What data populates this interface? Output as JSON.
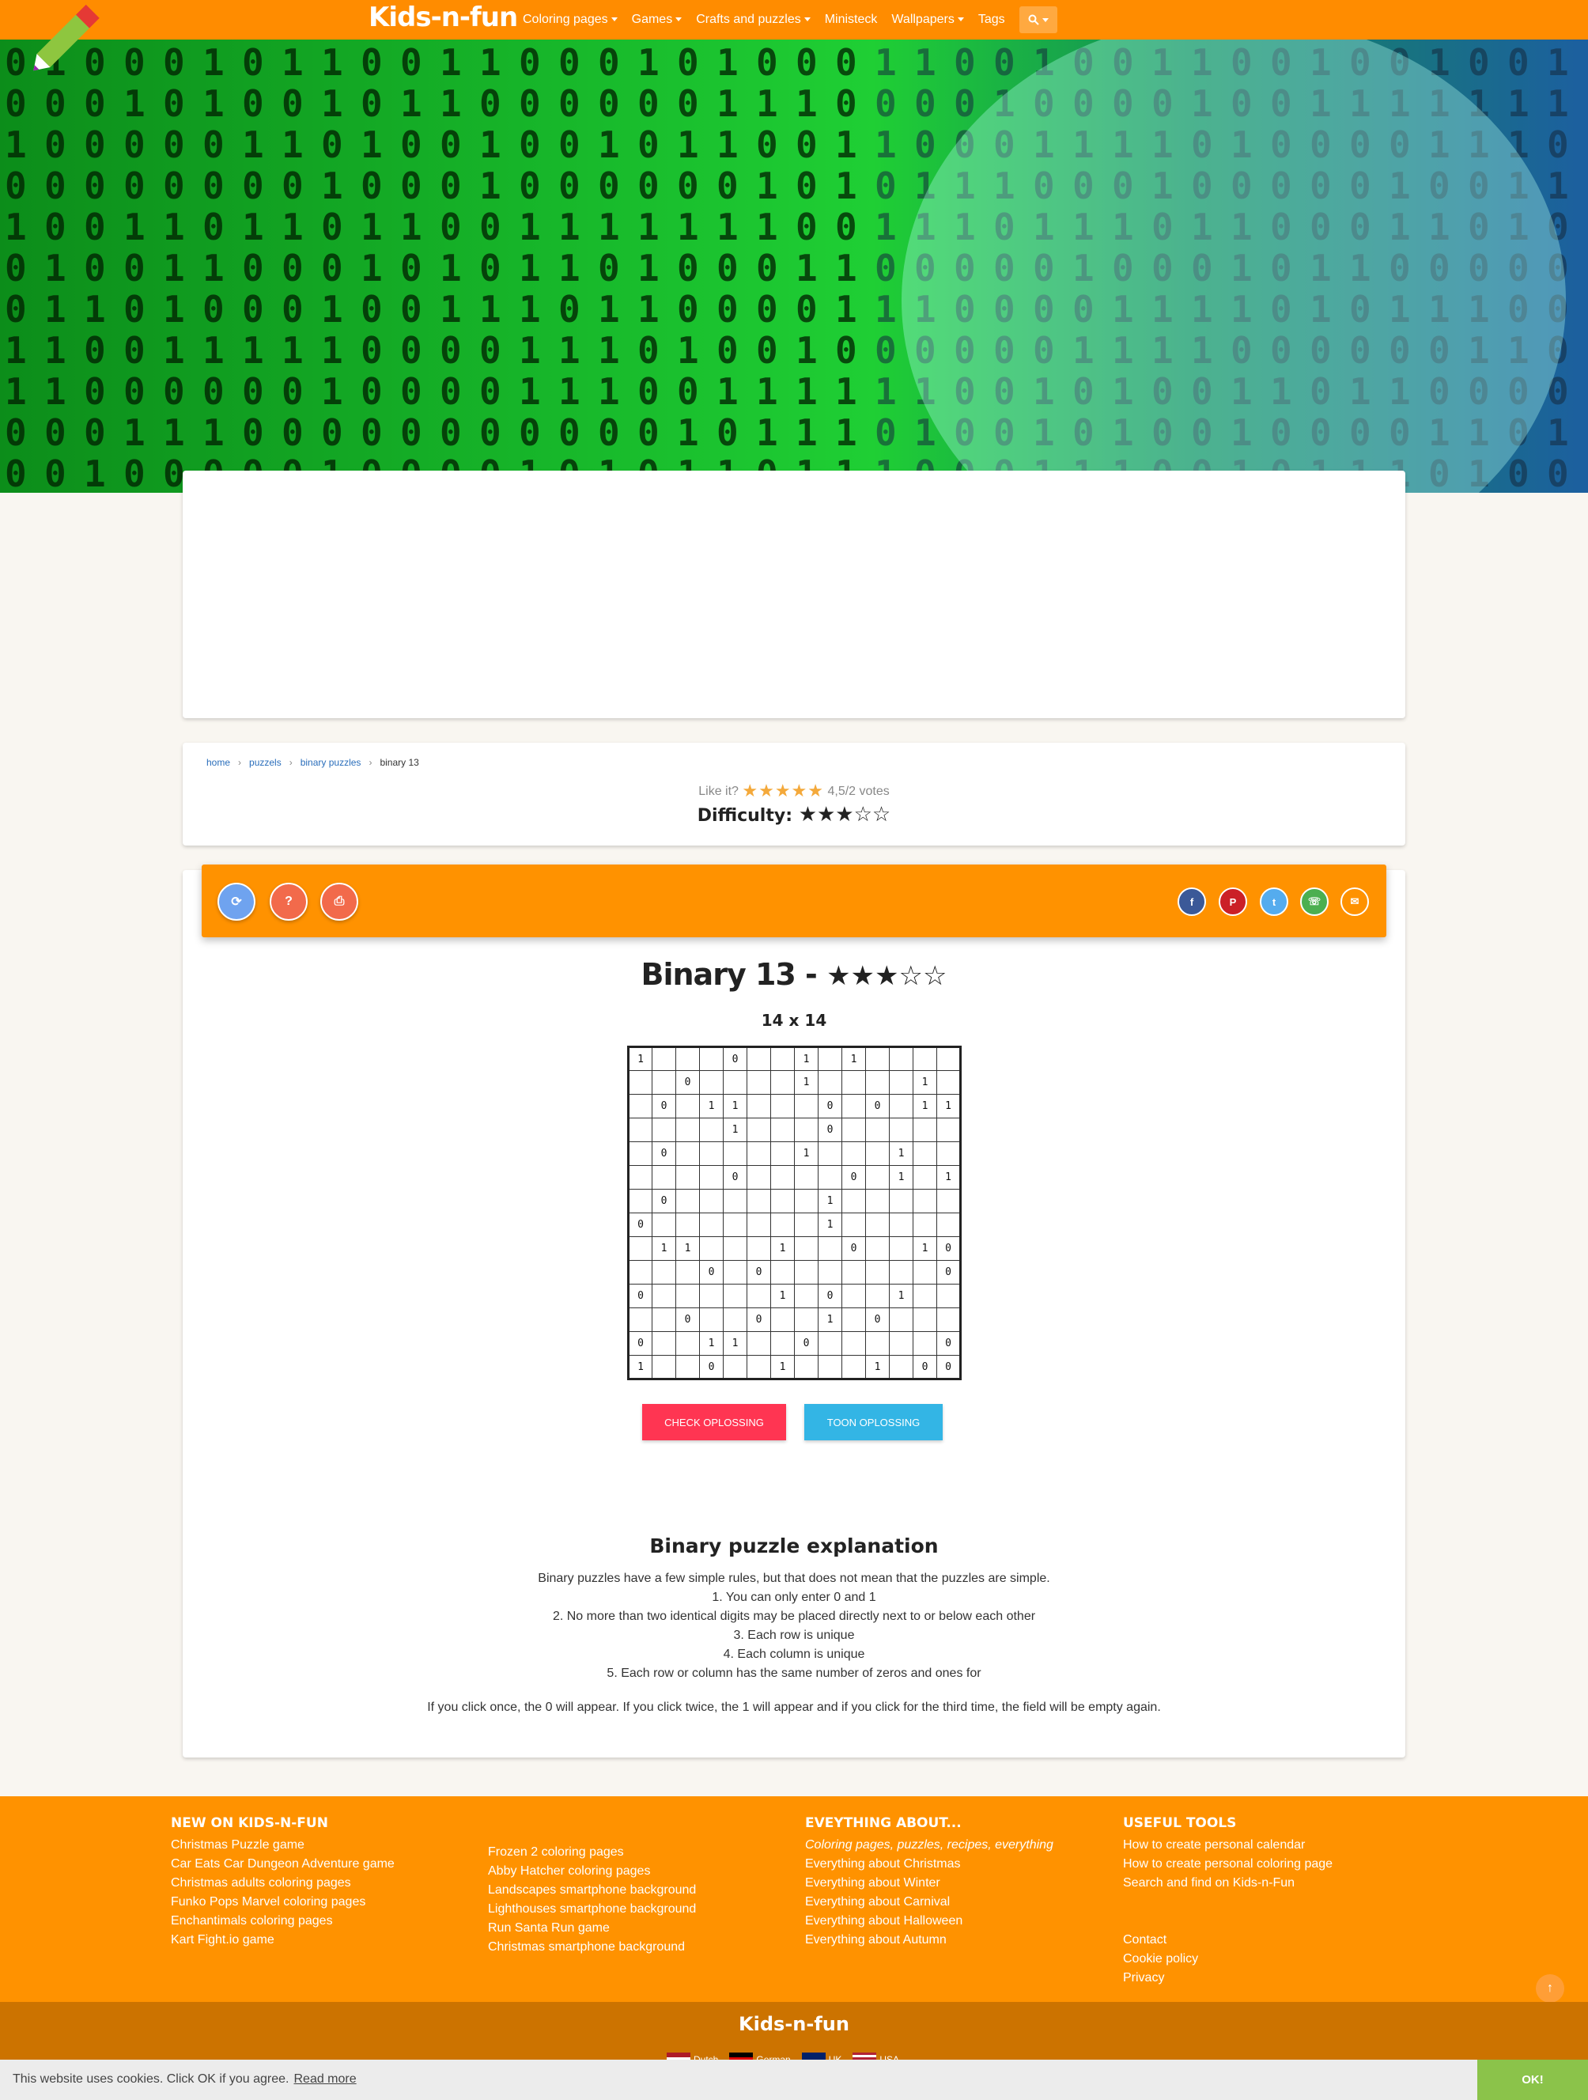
{
  "nav": {
    "brand": "Kids-n-fun",
    "items": [
      {
        "label": "Coloring pages",
        "dropdown": true
      },
      {
        "label": "Games",
        "dropdown": true
      },
      {
        "label": "Crafts and puzzles",
        "dropdown": true
      },
      {
        "label": "Ministeck",
        "dropdown": false
      },
      {
        "label": "Wallpapers",
        "dropdown": true
      },
      {
        "label": "Tags",
        "dropdown": false
      }
    ],
    "search_icon": "search-icon"
  },
  "breadcrumb": {
    "items": [
      "home",
      "puzzels",
      "binary puzzles"
    ],
    "current": "binary 13"
  },
  "rating": {
    "prefix": "Like it?",
    "stars": "★★★★★",
    "votes": "4,5/2 votes",
    "difficulty_label": "Difficulty:",
    "difficulty_stars": "★★★☆☆",
    "difficulty_level": 3
  },
  "toolbar": {
    "tools": [
      {
        "icon": "refresh-icon",
        "glyph": "⟳",
        "color": "#6fa3ef"
      },
      {
        "icon": "help-icon",
        "glyph": "?",
        "color": "#f26a4b"
      },
      {
        "icon": "print-icon",
        "glyph": "⎙",
        "color": "#f26a4b"
      }
    ],
    "share": [
      {
        "icon": "facebook-icon",
        "glyph": "f",
        "color": "#3b5998"
      },
      {
        "icon": "pinterest-icon",
        "glyph": "P",
        "color": "#cb2027"
      },
      {
        "icon": "twitter-icon",
        "glyph": "t",
        "color": "#55acee"
      },
      {
        "icon": "whatsapp-icon",
        "glyph": "☏",
        "color": "#4caf50"
      },
      {
        "icon": "email-icon",
        "glyph": "✉",
        "color": "#ff9200"
      }
    ]
  },
  "puzzle": {
    "title": "Binary 13 -",
    "title_stars": "★★★☆☆",
    "size": "14 x 14",
    "grid": [
      [
        "1",
        "",
        "",
        "",
        "0",
        "",
        "",
        "1",
        "",
        "1",
        "",
        "",
        "",
        ""
      ],
      [
        "",
        "",
        "0",
        "",
        "",
        "",
        "",
        "1",
        "",
        "",
        "",
        "",
        "1",
        ""
      ],
      [
        "",
        "0",
        "",
        "1",
        "1",
        "",
        "",
        "",
        "0",
        "",
        "0",
        "",
        "1",
        "1"
      ],
      [
        "",
        "",
        "",
        "",
        "1",
        "",
        "",
        "",
        "0",
        "",
        "",
        "",
        "",
        ""
      ],
      [
        "",
        "0",
        "",
        "",
        "",
        "",
        "",
        "1",
        "",
        "",
        "",
        "1",
        "",
        ""
      ],
      [
        "",
        "",
        "",
        "",
        "0",
        "",
        "",
        "",
        "",
        "0",
        "",
        "1",
        "",
        "1"
      ],
      [
        "",
        "0",
        "",
        "",
        "",
        "",
        "",
        "",
        "1",
        "",
        "",
        "",
        "",
        ""
      ],
      [
        "0",
        "",
        "",
        "",
        "",
        "",
        "",
        "",
        "1",
        "",
        "",
        "",
        "",
        ""
      ],
      [
        "",
        "1",
        "1",
        "",
        "",
        "",
        "1",
        "",
        "",
        "0",
        "",
        "",
        "1",
        "0"
      ],
      [
        "",
        "",
        "",
        "0",
        "",
        "0",
        "",
        "",
        "",
        "",
        "",
        "",
        "",
        "0"
      ],
      [
        "0",
        "",
        "",
        "",
        "",
        "",
        "1",
        "",
        "0",
        "",
        "",
        "1",
        "",
        ""
      ],
      [
        "",
        "",
        "0",
        "",
        "",
        "0",
        "",
        "",
        "1",
        "",
        "0",
        "",
        "",
        ""
      ],
      [
        "0",
        "",
        "",
        "1",
        "1",
        "",
        "",
        "0",
        "",
        "",
        "",
        "",
        "",
        "0"
      ],
      [
        "1",
        "",
        "",
        "0",
        "",
        "",
        "1",
        "",
        "",
        "",
        "1",
        "",
        "0",
        "0"
      ]
    ],
    "check_label": "CHECK OPLOSSING",
    "show_label": "TOON OPLOSSING"
  },
  "explanation": {
    "title": "Binary puzzle explanation",
    "lines": [
      "Binary puzzles have a few simple rules, but that does not mean that the puzzles are simple.",
      "1. You can only enter 0 and 1",
      "2. No more than two identical digits may be placed directly next to or below each other",
      "3. Each row is unique",
      "4. Each column is unique",
      "5. Each row or column has the same number of zeros and ones for"
    ],
    "note": "If you click once, the 0 will appear. If you click twice, the 1 will appear and if you click for the third time, the field will be empty again."
  },
  "footer": {
    "col1": {
      "title": "NEW ON KIDS-N-FUN",
      "links": [
        "Christmas Puzzle game",
        "Car Eats Car Dungeon Adventure game",
        "Christmas adults coloring pages",
        "Funko Pops Marvel coloring pages",
        "Enchantimals coloring pages",
        "Kart Fight.io game"
      ]
    },
    "col2": {
      "links": [
        "Frozen 2 coloring pages",
        "Abby Hatcher coloring pages",
        "Landscapes smartphone background",
        "Lighthouses smartphone background",
        "Run Santa Run game",
        "Christmas smartphone background"
      ]
    },
    "col3": {
      "title": "EVEYTHING ABOUT...",
      "subtitle": "Coloring pages, puzzles, recipes, everything",
      "links": [
        "Everything about Christmas",
        "Everything about Winter",
        "Everything about Carnival",
        "Everything about Halloween",
        "Everything about Autumn"
      ]
    },
    "col4": {
      "title": "USEFUL TOOLS",
      "links": [
        "How to create personal calendar",
        "How to create personal coloring page",
        "Search and find on Kids-n-Fun"
      ],
      "links2": [
        "Contact",
        "Cookie policy",
        "Privacy"
      ]
    },
    "brand": "Kids-n-fun",
    "languages": [
      "Dutch",
      "German",
      "UK",
      "USA"
    ]
  },
  "cookie": {
    "text": "This website uses cookies. Click OK if you agree.",
    "link": "Read more",
    "ok": "OK!"
  },
  "colors": {
    "primary": "#ff9200",
    "nav": "#ff8c00",
    "footer_dark": "#cc7300",
    "check": "#ff3552",
    "show": "#33b5e5",
    "cookie_ok": "#8bc34a"
  }
}
